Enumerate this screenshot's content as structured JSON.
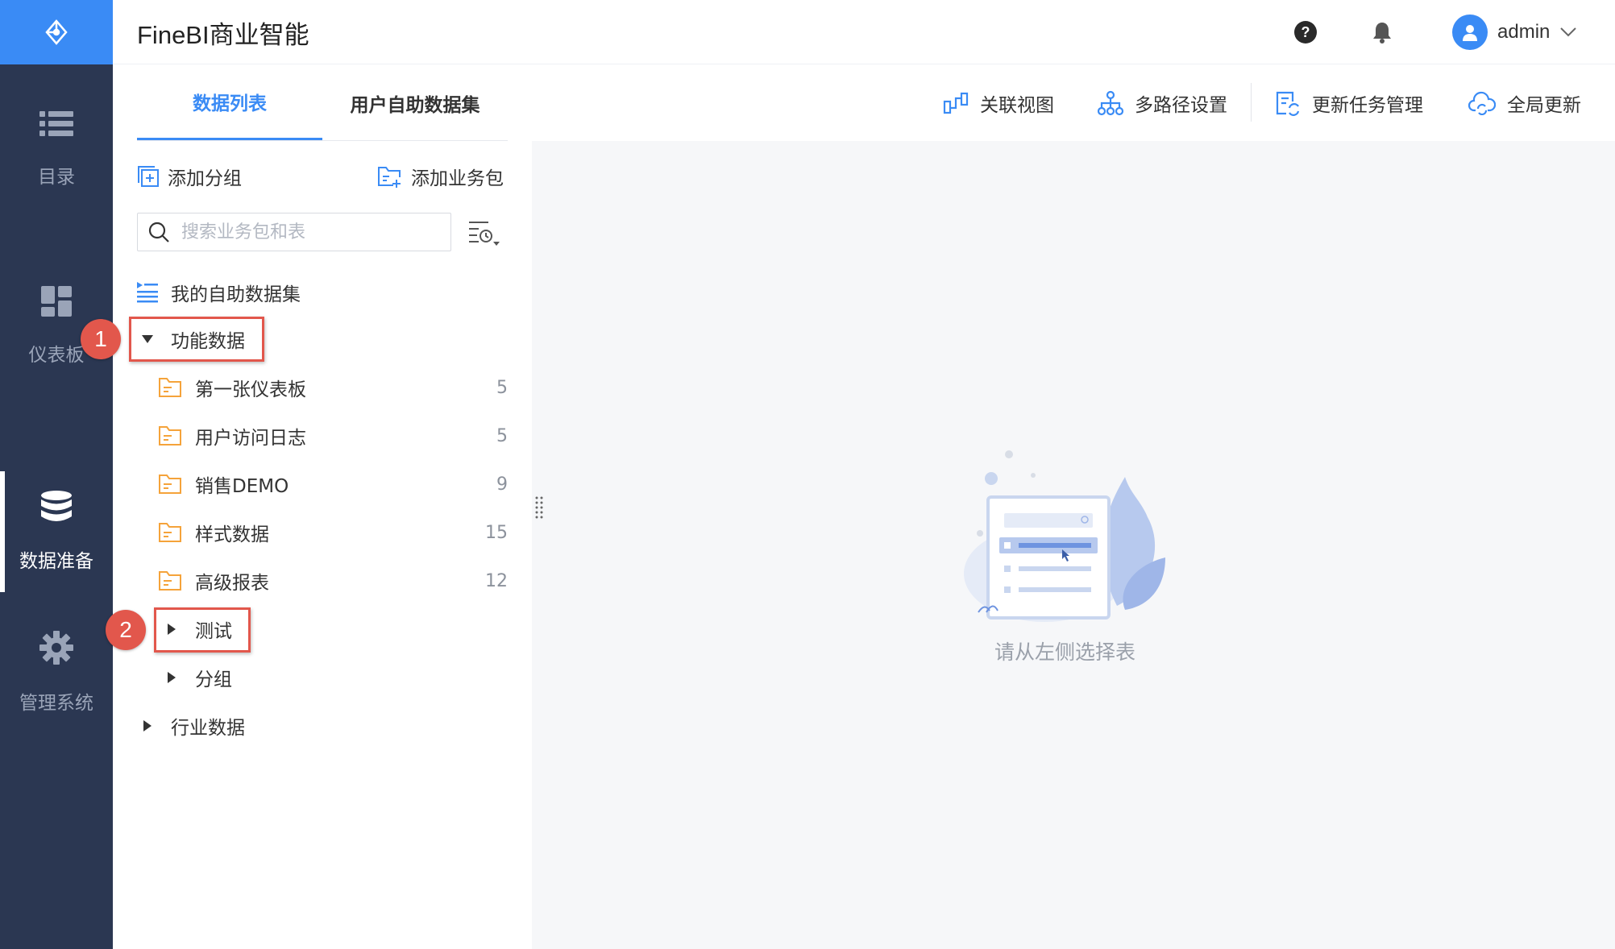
{
  "app": {
    "title": "FineBI商业智能"
  },
  "sidebar": {
    "items": [
      {
        "label": "目录",
        "icon": "list-icon"
      },
      {
        "label": "仪表板",
        "icon": "dashboard-icon"
      },
      {
        "label": "数据准备",
        "icon": "database-icon",
        "active": true
      },
      {
        "label": "管理系统",
        "icon": "gear-icon"
      }
    ]
  },
  "header": {
    "user_name": "admin"
  },
  "tabs": [
    {
      "label": "数据列表",
      "active": true
    },
    {
      "label": "用户自助数据集",
      "active": false
    }
  ],
  "toolbar": [
    {
      "label": "关联视图",
      "icon": "relation-view-icon"
    },
    {
      "label": "多路径设置",
      "icon": "multipath-icon"
    },
    {
      "label": "更新任务管理",
      "icon": "update-task-icon"
    },
    {
      "label": "全局更新",
      "icon": "cloud-refresh-icon"
    }
  ],
  "panel": {
    "add_group": "添加分组",
    "add_package": "添加业务包",
    "search_placeholder": "搜索业务包和表"
  },
  "tree": {
    "my_dataset": "我的自助数据集",
    "group1": {
      "label": "功能数据",
      "expanded": true
    },
    "packages": [
      {
        "label": "第一张仪表板",
        "count": "5"
      },
      {
        "label": "用户访问日志",
        "count": "5"
      },
      {
        "label": "销售DEMO",
        "count": "9"
      },
      {
        "label": "样式数据",
        "count": "15"
      },
      {
        "label": "高级报表",
        "count": "12"
      }
    ],
    "sub1": "测试",
    "sub2": "分组",
    "group2": "行业数据"
  },
  "annotations": {
    "step1": "1",
    "step2": "2"
  },
  "empty_state": {
    "text": "请从左侧选择表"
  },
  "colors": {
    "accent": "#3a8bf5",
    "sidebar": "#2b3752",
    "highlight": "#e2574c",
    "folder": "#f5a33a"
  }
}
